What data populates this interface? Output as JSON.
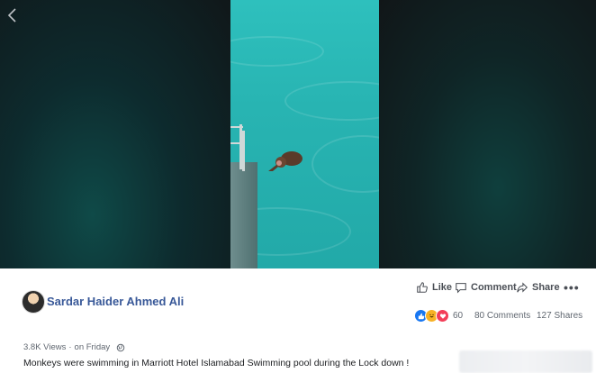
{
  "post": {
    "author": "Sardar Haider Ahmed Ali",
    "views": "3.8K Views",
    "separator": " · ",
    "time": "on Friday",
    "caption": "Monkeys were swimming in Marriott Hotel Islamabad Swimming pool during the Lock down !"
  },
  "actions": {
    "like_label": "Like",
    "comment_label": "Comment",
    "share_label": "Share",
    "more_label": "•••"
  },
  "stats": {
    "reaction_count": "60",
    "comments": "80 Comments",
    "shares": "127 Shares"
  },
  "icons": {
    "back": "chevron-left-icon",
    "like": "thumbs-up-icon",
    "comment": "speech-bubble-icon",
    "share": "share-arrow-icon",
    "privacy": "globe-icon"
  },
  "colors": {
    "author_link": "#385898",
    "like_reaction": "#1877f2",
    "haha_reaction": "#f7b125",
    "love_reaction": "#f33e58",
    "pool_water": "#2ab7b5"
  }
}
